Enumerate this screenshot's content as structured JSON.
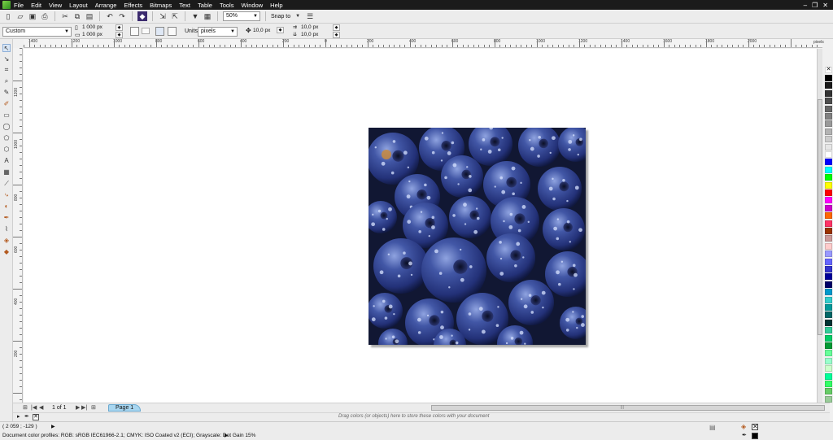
{
  "menu": {
    "items": [
      "File",
      "Edit",
      "View",
      "Layout",
      "Arrange",
      "Effects",
      "Bitmaps",
      "Text",
      "Table",
      "Tools",
      "Window",
      "Help"
    ]
  },
  "toolbar": {
    "zoom": "50%",
    "snap_to": "Snap to"
  },
  "property_bar": {
    "preset": "Custom",
    "width": "1 000 px",
    "height": "1 000 px",
    "units_label": "Units:",
    "units": "pixels",
    "nudge": "10,0 px",
    "dup_x": "10,0 px",
    "dup_y": "10,0 px"
  },
  "ruler": {
    "unit": "pixels",
    "h_labels": [
      "1400",
      "1200",
      "1000",
      "800",
      "600",
      "400",
      "200",
      "0",
      "200",
      "400",
      "600",
      "800",
      "1000",
      "1200",
      "1400",
      "1600",
      "1800",
      "2000"
    ],
    "v_labels": [
      "1200",
      "1000",
      "800",
      "600",
      "400",
      "200",
      "0"
    ]
  },
  "navigator": {
    "page_count": "1 of 1",
    "page_tab": "Page 1"
  },
  "doc_palette_hint": "Drag colors (or objects) here to store these colors with your document",
  "status": {
    "coords": "( 2 059 ; -129 )",
    "profiles": "Document color profiles: RGB: sRGB IEC61966-2.1; CMYK: ISO Coated v2 (ECI); Grayscale: Dot Gain 15%"
  },
  "palette_colors": [
    "#000000",
    "#1a1a1a",
    "#333333",
    "#4d4d4d",
    "#666666",
    "#808080",
    "#999999",
    "#b3b3b3",
    "#cccccc",
    "#e6e6e6",
    "#ffffff",
    "#0000ff",
    "#00ffff",
    "#00ff00",
    "#ffff00",
    "#ff0000",
    "#ff00ff",
    "#cc00cc",
    "#ff6600",
    "#ff3366",
    "#993300",
    "#cc9999",
    "#ffcccc",
    "#9999ff",
    "#6666ff",
    "#3333cc",
    "#000099",
    "#000066",
    "#0099cc",
    "#33cccc",
    "#009999",
    "#006666",
    "#003333",
    "#33cc99",
    "#00cc66",
    "#009933",
    "#66ff99",
    "#99ffcc",
    "#ccffcc",
    "#00ff99",
    "#33ff66",
    "#66cc66",
    "#99cc99"
  ]
}
